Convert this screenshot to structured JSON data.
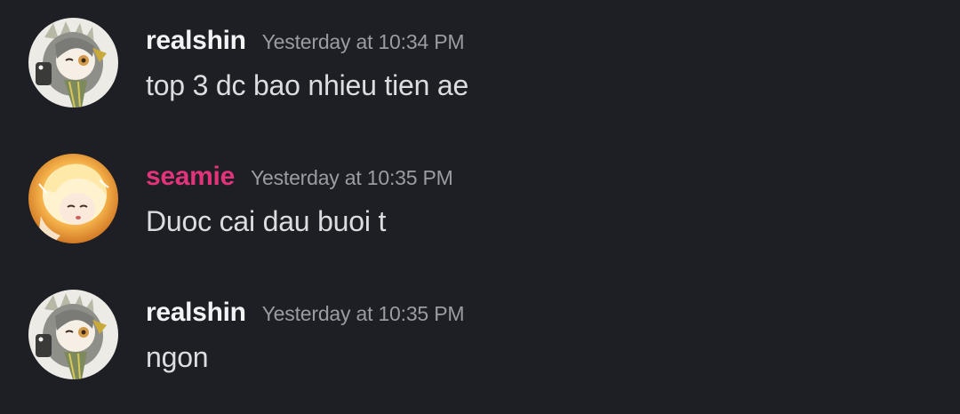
{
  "colors": {
    "background": "#1e1f24",
    "username_default": "#f2f3f5",
    "username_seamie": "#e3337a",
    "timestamp": "#9a9ca3",
    "message_text": "#dbdee1"
  },
  "messages": [
    {
      "author": "realshin",
      "timestamp": "Yesterday at 10:34 PM",
      "content": "top 3 dc bao nhieu tien ae",
      "avatar_icon": "anime-girl-gray-hair-avatar-icon"
    },
    {
      "author": "seamie",
      "timestamp": "Yesterday at 10:35 PM",
      "content": "Duoc cai dau buoi t",
      "avatar_icon": "anime-girl-blonde-hair-avatar-icon"
    },
    {
      "author": "realshin",
      "timestamp": "Yesterday at 10:35 PM",
      "content": "ngon",
      "avatar_icon": "anime-girl-gray-hair-avatar-icon"
    }
  ]
}
